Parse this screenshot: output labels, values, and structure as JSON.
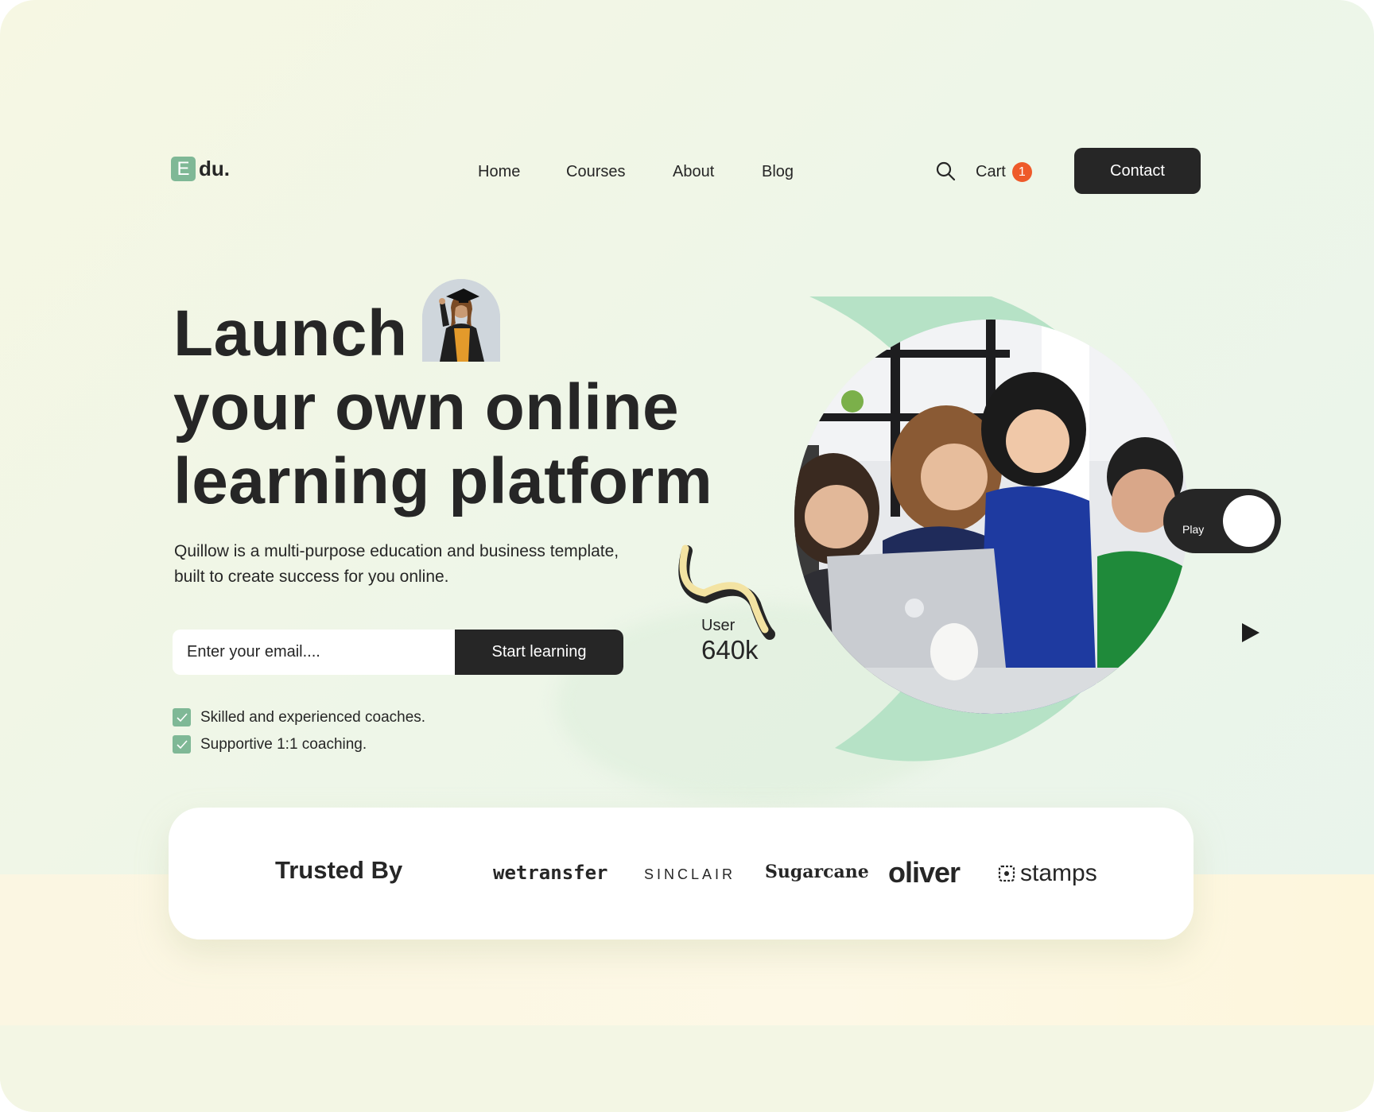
{
  "nav": {
    "logo_mark": "E",
    "logo_text": "du.",
    "links": [
      "Home",
      "Courses",
      "About",
      "Blog"
    ],
    "cart_label": "Cart",
    "cart_count": "1",
    "contact_label": "Contact"
  },
  "hero": {
    "headline_line1": "Launch",
    "headline_line2": "your own online",
    "headline_line3": "learning platform",
    "subtext": "Quillow is a multi-purpose education and business template, built to create success for you online.",
    "email_placeholder": "Enter your email....",
    "start_button": "Start learning",
    "checks": [
      "Skilled and experienced coaches.",
      "Supportive 1:1 coaching."
    ],
    "user_label": "User",
    "user_value": "640k",
    "play_label": "Play"
  },
  "trusted": {
    "title": "Trusted By",
    "brands": [
      "wetransfer",
      "SINCLAIR",
      "Sugarcane",
      "oliver",
      "stamps"
    ]
  },
  "colors": {
    "accent_green": "#7fb896",
    "ring_green": "#b6e2c6",
    "dark": "#262626",
    "badge_orange": "#ee5a2a",
    "squiggle_yellow": "#f3e3a2"
  }
}
